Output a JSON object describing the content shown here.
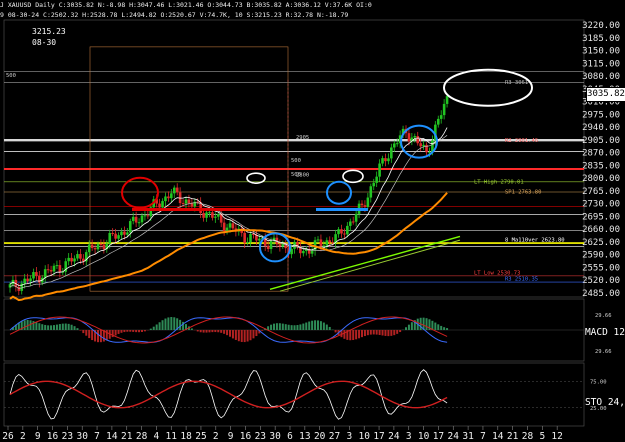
{
  "header": {
    "line1": "J XAUUSD Daily C:3035.82 N:-8.98 H:3047.46 L:3021.46 O:3044.73 B:3035.82 A:3036.12 V:37.6K OI:0",
    "line2": "9 08-30-24 C:2502.32 H:2528.78 L:2494.82 O:2520.67 V:74.7K, 10 S:3215.23 R:32.78 N:-18.79"
  },
  "info": {
    "value": "3215.23",
    "date": "08-30"
  },
  "last_price": "3035.82",
  "price_axis": {
    "min": 2485,
    "max": 3220,
    "labels": [
      "3220.00",
      "3185.00",
      "3150.00",
      "3115.00",
      "3080.00",
      "3045.00",
      "3010.00",
      "2975.00",
      "2940.00",
      "2905.00",
      "2870.00",
      "2835.00",
      "2800.00",
      "2765.00",
      "2730.00",
      "2695.00",
      "2660.00",
      "2625.00",
      "2590.00",
      "2555.00",
      "2520.00",
      "2485.00"
    ]
  },
  "annotations": {
    "r3": "R3 3061",
    "r2": "R2 2901.46",
    "lt_high": "LT High 2790.01",
    "s1": "SP1 2763.80",
    "ma_label": "8 Ma110ver 2623.80",
    "lt_low": "LT Low 2530.73",
    "s3": "R3 2510.35",
    "box_top": "500",
    "mid_500_a": "500",
    "mid_500_b": "500",
    "level_2905": "2905",
    "level_2800": "2800"
  },
  "indicators": {
    "macd_label": "MACD 12",
    "macd_val1": "29.66",
    "macd_val2": "29.66",
    "sto_label": "STO 24,",
    "sto_val1": "75.00",
    "sto_val2": "25.00"
  },
  "x_axis": [
    "26",
    "2",
    "9",
    "16",
    "23",
    "30",
    "7",
    "14",
    "21",
    "28",
    "4",
    "11",
    "18",
    "25",
    "2",
    "9",
    "16",
    "23",
    "30",
    "6",
    "13",
    "20",
    "27",
    "3",
    "10",
    "17",
    "24",
    "3",
    "10",
    "17",
    "24",
    "31",
    "7",
    "14",
    "21",
    "28",
    "5",
    "12"
  ],
  "colors": {
    "up": "#22c522",
    "down": "#e02a2a",
    "ma_orange": "#ff8c00",
    "ma_green": "#7cfc00",
    "annotation_blue": "#1e90ff"
  }
}
